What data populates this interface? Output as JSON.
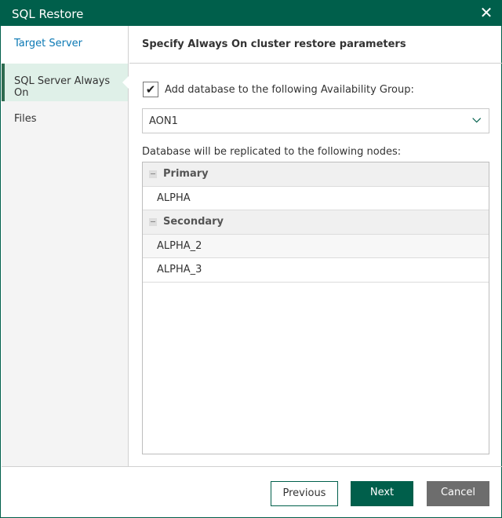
{
  "window": {
    "title": "SQL Restore",
    "close_icon": "close-icon"
  },
  "sidebar": {
    "items": [
      {
        "label": "Target Server"
      },
      {
        "label": "SQL Server Always On"
      },
      {
        "label": "Files"
      }
    ]
  },
  "header": {
    "title": "Specify Always On cluster restore parameters"
  },
  "form": {
    "checkbox_label": "Add database to the following Availability Group:",
    "checked": true,
    "group_value": "AON1",
    "nodes_label": "Database will be replicated to the following nodes:"
  },
  "nodes": {
    "primary": {
      "label": "Primary",
      "items": [
        "ALPHA"
      ]
    },
    "secondary": {
      "label": "Secondary",
      "items": [
        "ALPHA_2",
        "ALPHA_3"
      ]
    }
  },
  "footer": {
    "previous": "Previous",
    "next": "Next",
    "cancel": "Cancel"
  }
}
